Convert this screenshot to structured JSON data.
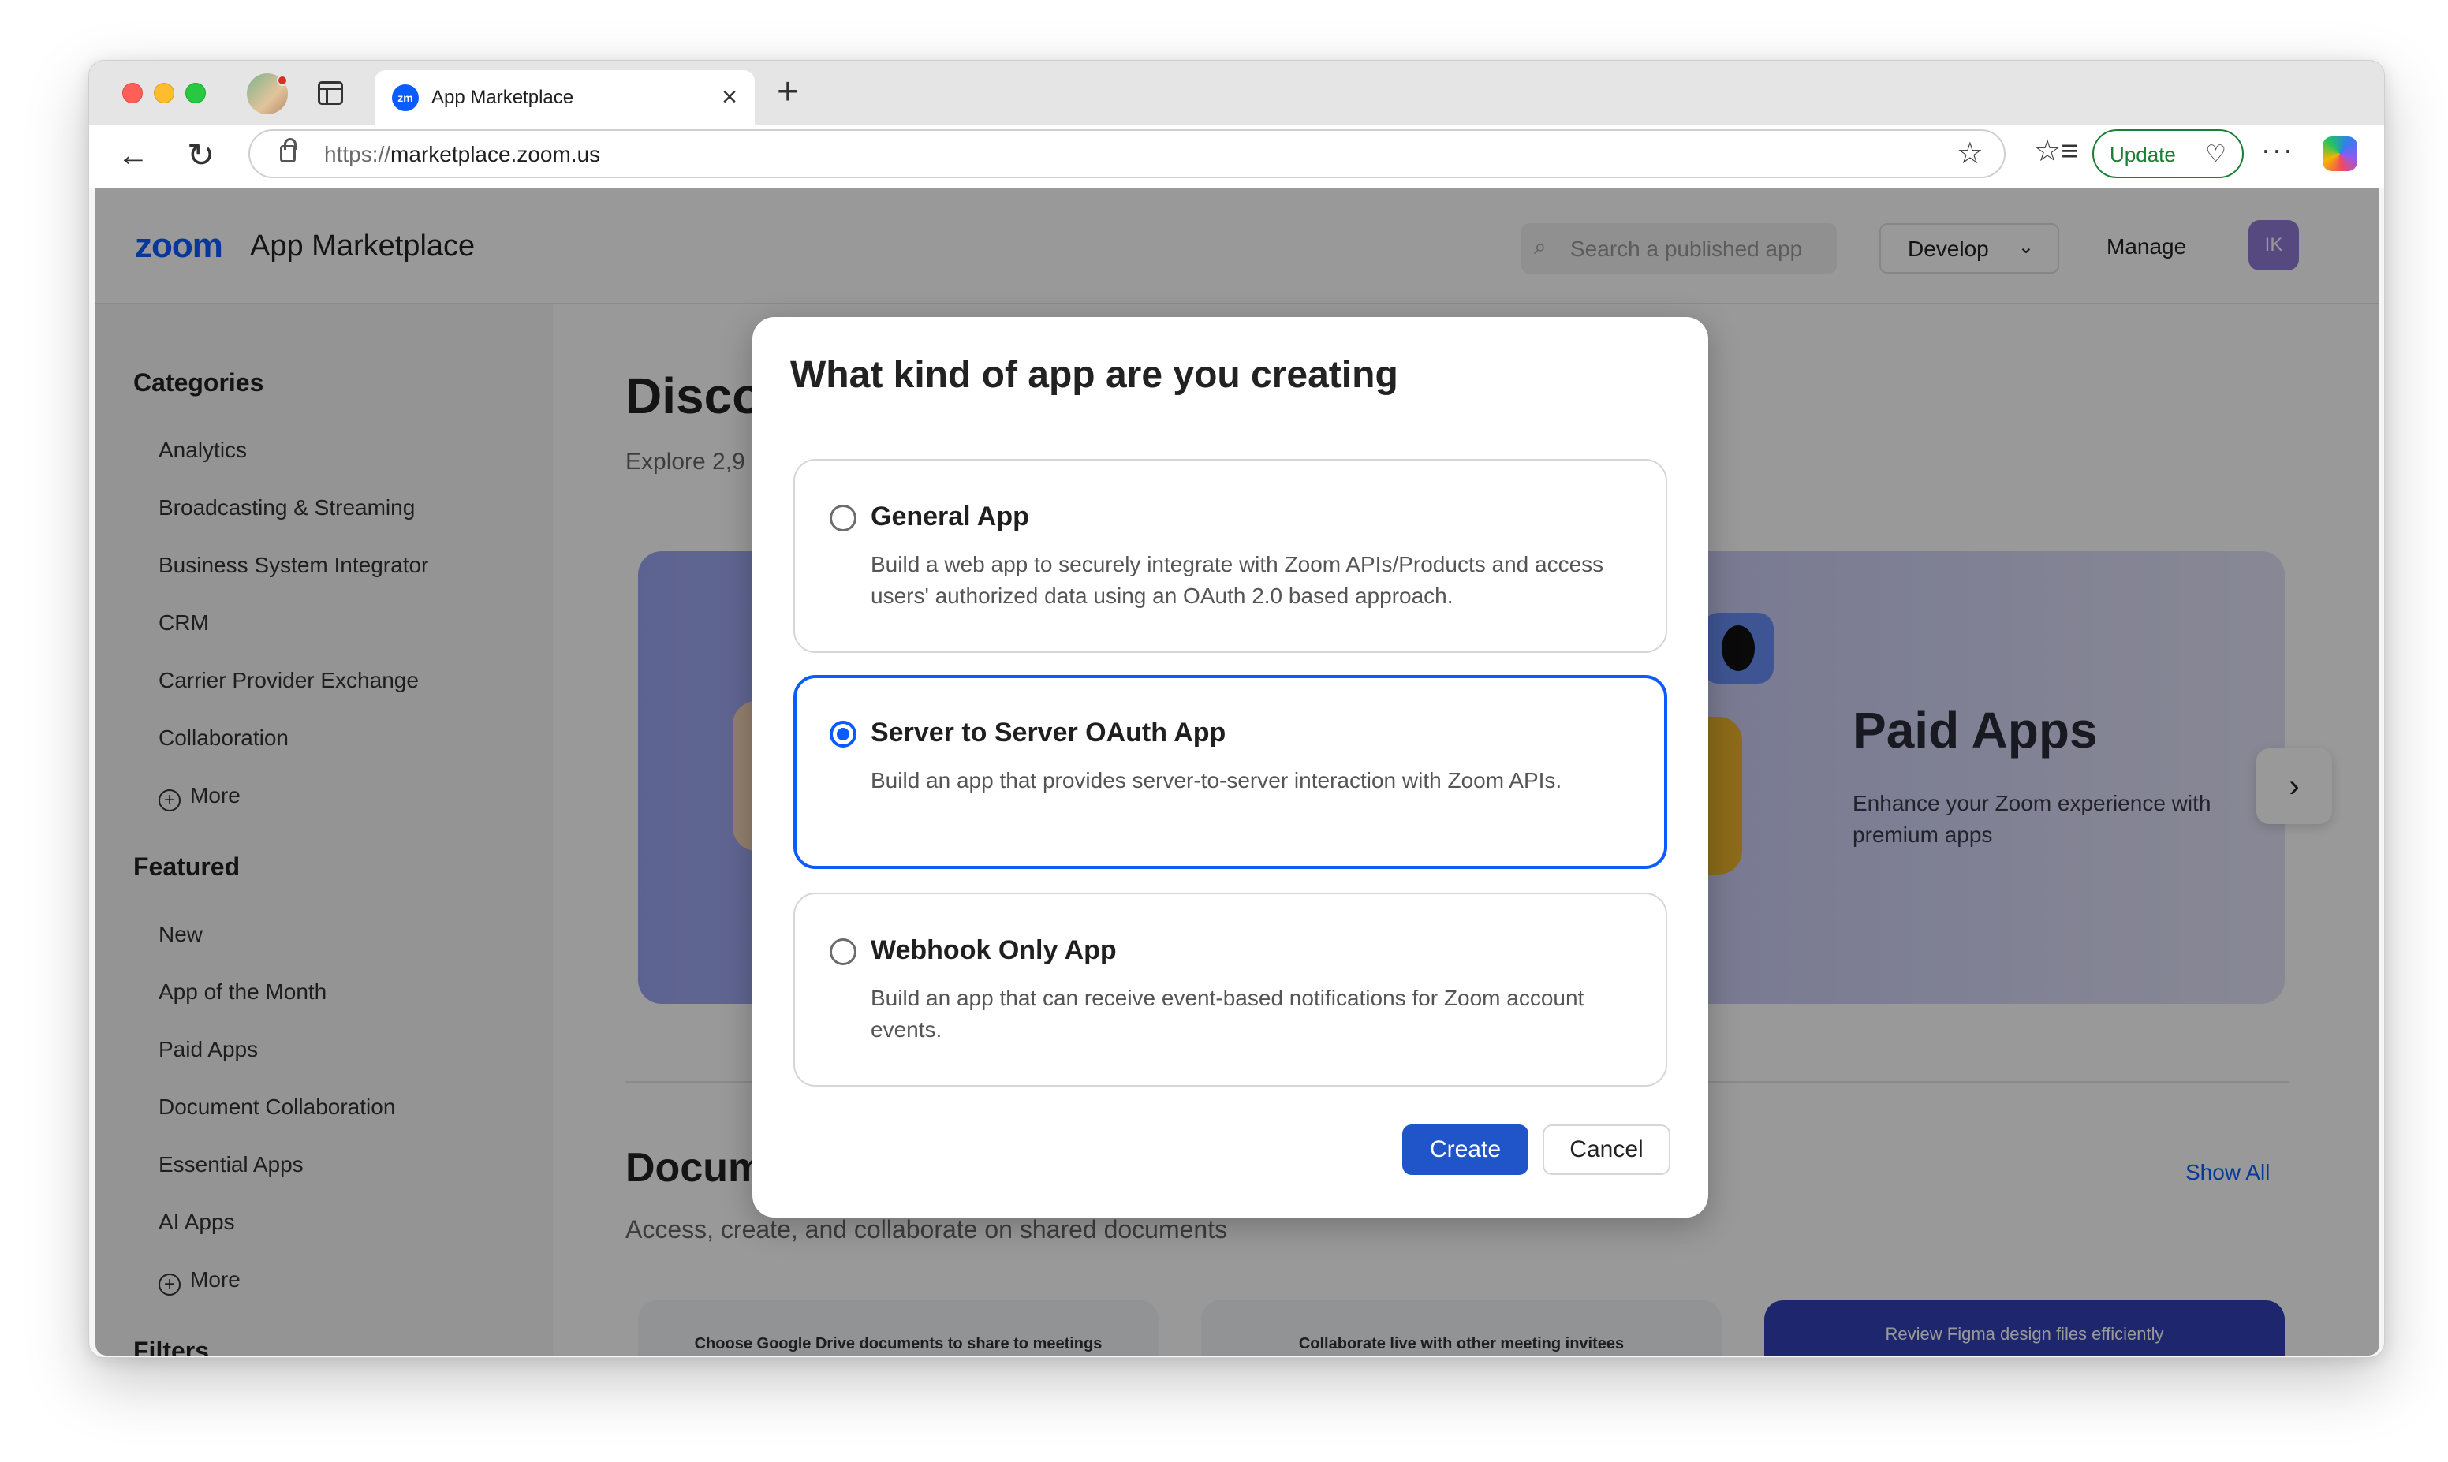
{
  "browser": {
    "tab_title": "App Marketplace",
    "tab_favicon_text": "zm",
    "url_protocol": "https://",
    "url_host": "marketplace.zoom.us",
    "update_label": "Update",
    "icons": {
      "back": "back-arrow-icon",
      "reload": "reload-icon",
      "star": "star-icon",
      "favorites": "favorites-list-icon",
      "more": "more-dots-icon",
      "copilot": "copilot-icon"
    }
  },
  "site": {
    "logo_zoom": "zoom",
    "logo_title": "App Marketplace",
    "search_placeholder": "Search a published app",
    "develop_label": "Develop",
    "manage_label": "Manage",
    "avatar_initials": "IK"
  },
  "sidebar": {
    "categories_heading": "Categories",
    "categories": [
      "Analytics",
      "Broadcasting & Streaming",
      "Business System Integrator",
      "CRM",
      "Carrier Provider Exchange",
      "Collaboration"
    ],
    "more_label": "More",
    "featured_heading": "Featured",
    "featured": [
      "New",
      "App of the Month",
      "Paid Apps",
      "Document Collaboration",
      "Essential Apps",
      "AI Apps"
    ],
    "filters_heading": "Filters"
  },
  "main": {
    "title": "Disco",
    "subtitle": "Explore 2,9",
    "hero_title": "Paid Apps",
    "hero_subtitle": "Enhance your Zoom experience with premium apps",
    "section_title": "Docum",
    "section_subtitle": "Access, create, and collaborate on shared documents",
    "show_all": "Show All",
    "cards": [
      "Choose Google Drive documents to share to meetings",
      "Collaborate live with other meeting invitees",
      "Review Figma design files efficiently"
    ]
  },
  "modal": {
    "title": "What kind of app are you creating",
    "options": [
      {
        "title": "General App",
        "description": "Build a web app to securely integrate with Zoom APIs/Products and access users' authorized data using an OAuth 2.0 based approach.",
        "selected": false
      },
      {
        "title": "Server to Server OAuth App",
        "description": "Build an app that provides server-to-server interaction with Zoom APIs.",
        "selected": true
      },
      {
        "title": "Webhook Only App",
        "description": "Build an app that can receive event-based notifications for Zoom account events.",
        "selected": false
      }
    ],
    "create_label": "Create",
    "cancel_label": "Cancel"
  },
  "colors": {
    "accent": "#0b5cff",
    "primary_button": "#1f55c9",
    "update_green": "#1a7f37"
  }
}
